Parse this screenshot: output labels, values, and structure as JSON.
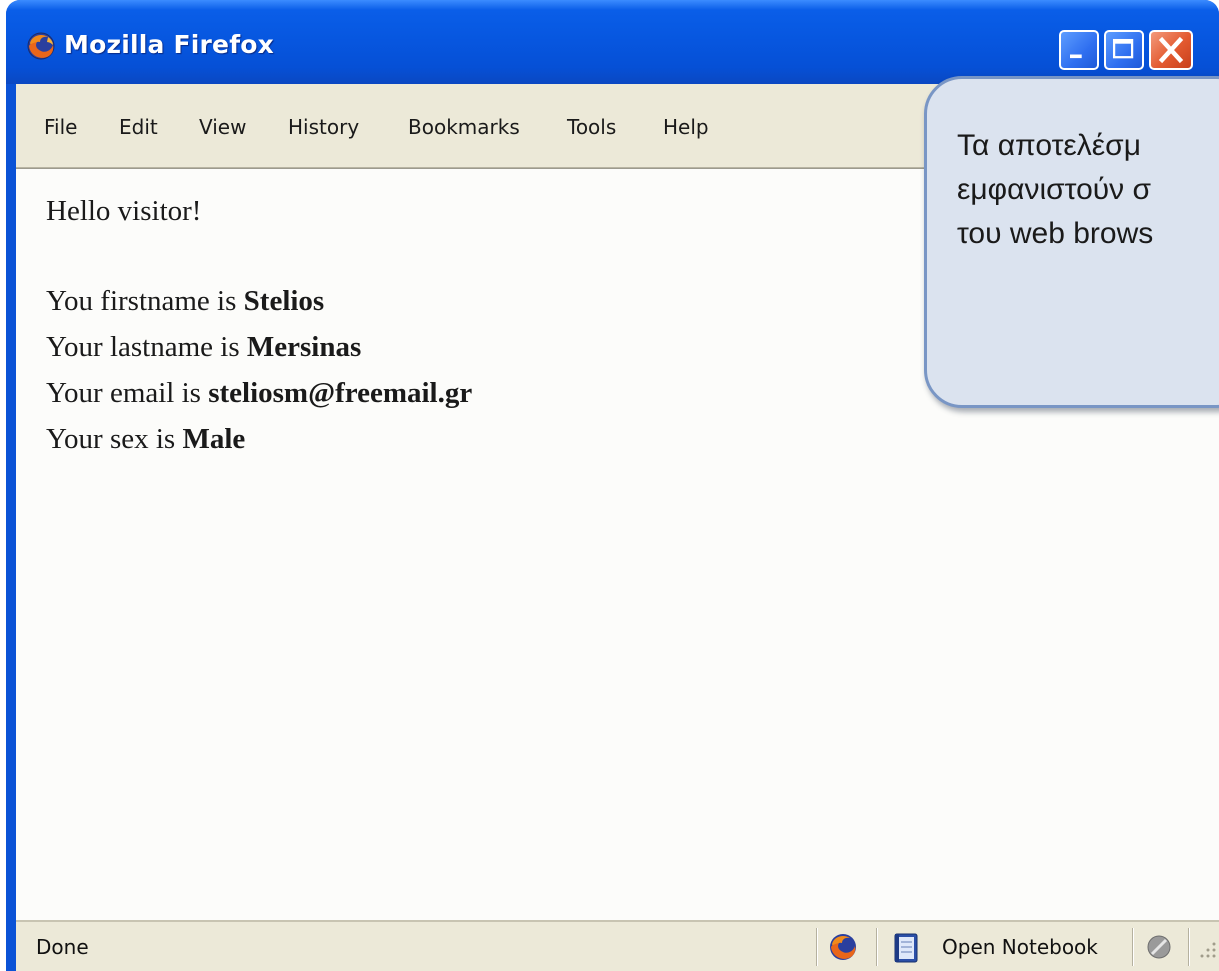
{
  "window": {
    "title": "Mozilla Firefox"
  },
  "menu": {
    "items": [
      "File",
      "Edit",
      "View",
      "History",
      "Bookmarks",
      "Tools",
      "Help"
    ]
  },
  "page": {
    "greeting": "Hello visitor!",
    "firstname": {
      "label": "You firstname is ",
      "value": "Stelios"
    },
    "lastname": {
      "label": "Your lastname is ",
      "value": "Mersinas"
    },
    "email": {
      "label": "Your email is ",
      "value": "steliosm@freemail.gr"
    },
    "sex": {
      "label": "Your sex is ",
      "value": "Male"
    }
  },
  "status": {
    "text": "Done",
    "notebook_label": "Open Notebook"
  },
  "callout": {
    "lines": [
      "Τα αποτελέσμ",
      "εμφανιστούν σ",
      "του web brows"
    ]
  },
  "colors": {
    "titlebar": "#0757e0",
    "chrome": "#ece9d8",
    "callout_fill": "#dbe3ef",
    "callout_border": "#7996c5"
  },
  "icons": {
    "app": "firefox-icon",
    "status": [
      "firefox-icon",
      "notebook-icon",
      "disabled-icon",
      "resize-grip-icon"
    ]
  }
}
